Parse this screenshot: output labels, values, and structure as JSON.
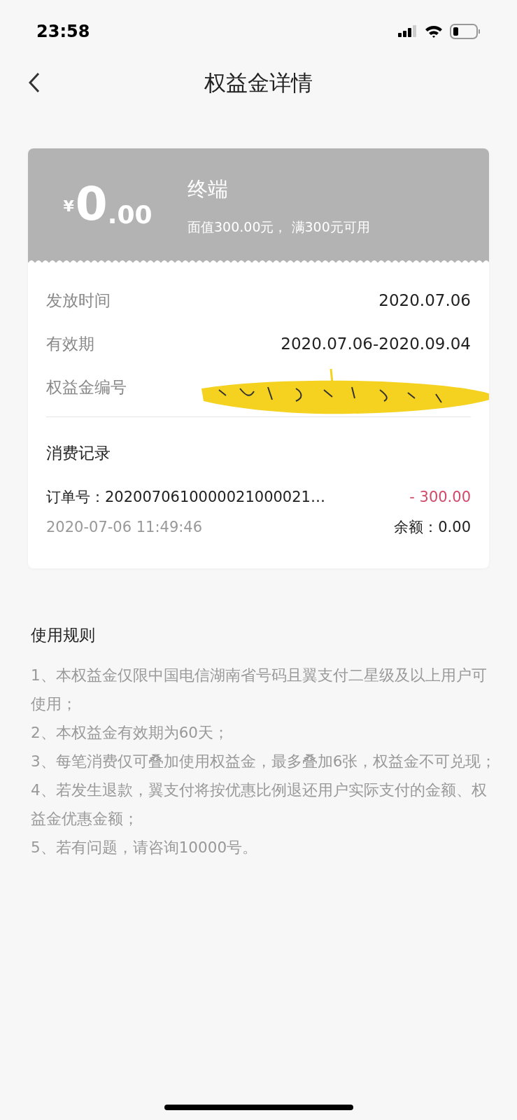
{
  "status_bar": {
    "time": "23:58"
  },
  "nav": {
    "title": "权益金详情"
  },
  "coupon": {
    "currency": "¥",
    "amount_integer": "0",
    "amount_decimal": ".00",
    "name": "终端",
    "description": "面值300.00元， 满300元可用"
  },
  "details": [
    {
      "label": "发放时间",
      "value": "2020.07.06",
      "redacted": false
    },
    {
      "label": "有效期",
      "value": "2020.07.06-2020.09.04",
      "redacted": false
    },
    {
      "label": "权益金编号",
      "redacted": true
    }
  ],
  "records": {
    "title": "消费记录",
    "items": [
      {
        "order": "订单号：2020070610000021000021…",
        "amount": "- 300.00",
        "time": "2020-07-06 11:49:46",
        "balance": "余额：0.00"
      }
    ]
  },
  "rules": {
    "title": "使用规则",
    "items": [
      "1、本权益金仅限中国电信湖南省号码且翼支付二星级及以上用户可使用；",
      "2、本权益金有效期为60天；",
      "3、每笔消费仅可叠加使用权益金，最多叠加6张，权益金不可兑现；",
      "4、若发生退款，翼支付将按优惠比例退还用户实际支付的金额、权益金优惠金额；",
      "5、若有问题，请咨询10000号。"
    ]
  }
}
